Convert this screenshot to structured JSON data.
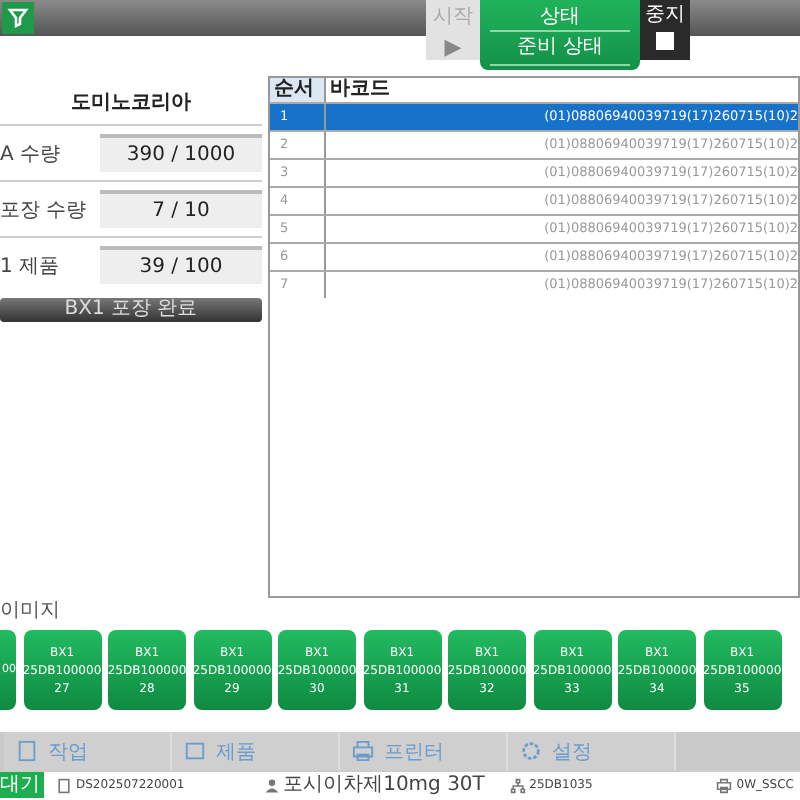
{
  "header": {
    "start_button": {
      "label": "시작",
      "icon": "▶"
    },
    "status": {
      "title": "상태",
      "value": "준비 상태"
    },
    "stop_button": {
      "label": "중지",
      "checked": false
    }
  },
  "left_panel": {
    "title": "도미노코리아",
    "fields": [
      {
        "label": "A 수량",
        "value": "390 / 1000"
      },
      {
        "label": "포장 수량",
        "value": "7 / 10"
      },
      {
        "label": "1 제품",
        "value": "39 / 100"
      }
    ],
    "action_button": "BX1 포장 완료"
  },
  "table": {
    "columns": [
      "순서",
      "바코드"
    ],
    "rows": [
      {
        "cells": [
          "1",
          "(01)08806940039719(17)260715(10)2"
        ],
        "selected": true
      },
      {
        "cells": [
          "2",
          "(01)08806940039719(17)260715(10)2"
        ],
        "selected": false
      },
      {
        "cells": [
          "3",
          "(01)08806940039719(17)260715(10)2"
        ],
        "selected": false
      },
      {
        "cells": [
          "4",
          "(01)08806940039719(17)260715(10)2"
        ],
        "selected": false
      },
      {
        "cells": [
          "5",
          "(01)08806940039719(17)260715(10)2"
        ],
        "selected": false
      },
      {
        "cells": [
          "6",
          "(01)08806940039719(17)260715(10)2"
        ],
        "selected": false
      },
      {
        "cells": [
          "7",
          "(01)08806940039719(17)260715(10)2"
        ],
        "selected": false
      }
    ]
  },
  "images_label": "이미지",
  "tiles": [
    {
      "kind": "partial",
      "lines": [
        "00"
      ]
    },
    {
      "kind": "full",
      "lines": [
        "BX1",
        "25DB100000",
        "27"
      ]
    },
    {
      "kind": "full",
      "lines": [
        "BX1",
        "25DB100000",
        "28"
      ]
    },
    {
      "kind": "full",
      "lines": [
        "BX1",
        "25DB100000",
        "29"
      ]
    },
    {
      "kind": "full",
      "lines": [
        "BX1",
        "25DB100000",
        "30"
      ]
    },
    {
      "kind": "full",
      "lines": [
        "BX1",
        "25DB100000",
        "31"
      ]
    },
    {
      "kind": "full",
      "lines": [
        "BX1",
        "25DB100000",
        "32"
      ]
    },
    {
      "kind": "full",
      "lines": [
        "BX1",
        "25DB100000",
        "33"
      ]
    },
    {
      "kind": "full",
      "lines": [
        "BX1",
        "25DB100000",
        "34"
      ]
    },
    {
      "kind": "full",
      "lines": [
        "BX1",
        "25DB100000",
        "35"
      ]
    }
  ],
  "toolbar": [
    {
      "label": "작업"
    },
    {
      "label": "제품"
    },
    {
      "label": "프린터"
    },
    {
      "label": "설정"
    }
  ],
  "status_bar": {
    "state": "대기",
    "items": [
      {
        "text": "DS202507220001"
      },
      {
        "text": "포시이차제10mg 30T"
      },
      {
        "text": "25DB1035"
      },
      {
        "text": "0W_SSCC"
      }
    ]
  }
}
